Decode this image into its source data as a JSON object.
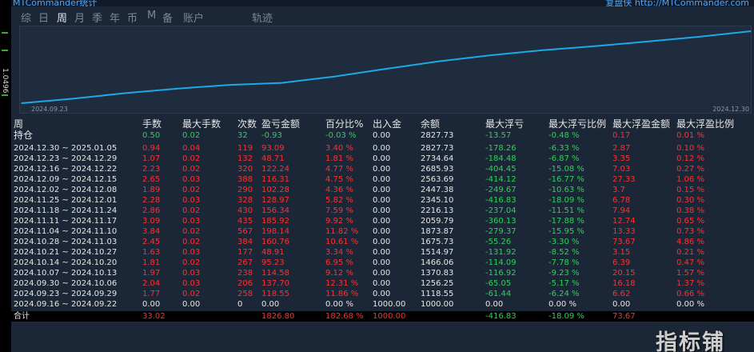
{
  "app": {
    "title_left": "MTCommander统计",
    "title_right": "复盘侠 http://MTCommander.com"
  },
  "side_label": "1.0496",
  "tabs": [
    "综",
    "日",
    "周",
    "月",
    "季",
    "年",
    "币",
    "M",
    "备",
    "账户",
    "轨迹"
  ],
  "active_tab": 2,
  "chart": {
    "start_date": "2024.09.23",
    "end_date": "2024.12.30"
  },
  "chart_data": {
    "type": "line",
    "x": [
      "2024.09.23",
      "2024.09.30",
      "2024.10.07",
      "2024.10.14",
      "2024.10.21",
      "2024.10.28",
      "2024.11.04",
      "2024.11.11",
      "2024.11.18",
      "2024.11.25",
      "2024.12.02",
      "2024.12.09",
      "2024.12.16",
      "2024.12.23",
      "2024.12.30"
    ],
    "y": [
      1000,
      1118.55,
      1256.25,
      1370.83,
      1466.06,
      1514.97,
      1675.73,
      1873.87,
      2059.79,
      2216.13,
      2345.1,
      2447.38,
      2563.69,
      2685.93,
      2827.73
    ],
    "line_color": "#1ea8e6",
    "grid": false
  },
  "table": {
    "headers": [
      "周",
      "手数",
      "最大手数",
      "次数",
      "盈亏金额",
      "百分比%",
      "出入金",
      "余额",
      "最大浮亏",
      "最大浮亏比例",
      "最大浮盈金额",
      "最大浮盈比例"
    ],
    "holding": {
      "label": "持仓",
      "cells": [
        "0.50",
        "0.02",
        "32",
        "-0.93",
        "-0.03 %",
        "0.00",
        "2827.73",
        "-13.57",
        "-0.48 %",
        "0.17",
        "0.01 %"
      ]
    },
    "rows": [
      {
        "period": "2024.12.30 ~ 2025.01.05",
        "cells": [
          "0.94",
          "0.04",
          "119",
          "93.09",
          "3.40 %",
          "0.00",
          "2827.73",
          "-178.26",
          "-6.33 %",
          "2.87",
          "0.10 %"
        ]
      },
      {
        "period": "2024.12.23 ~ 2024.12.29",
        "cells": [
          "1.07",
          "0.02",
          "132",
          "48.71",
          "1.81 %",
          "0.00",
          "2734.64",
          "-184.48",
          "-6.87 %",
          "3.35",
          "0.12 %"
        ]
      },
      {
        "period": "2024.12.16 ~ 2024.12.22",
        "cells": [
          "2.23",
          "0.02",
          "320",
          "122.24",
          "4.77 %",
          "0.00",
          "2685.93",
          "-404.45",
          "-15.08 %",
          "7.03",
          "0.27 %"
        ]
      },
      {
        "period": "2024.12.09 ~ 2024.12.15",
        "cells": [
          "2.65",
          "0.03",
          "388",
          "116.31",
          "4.75 %",
          "0.00",
          "2563.69",
          "-414.12",
          "-16.77 %",
          "27.33",
          "1.06 %"
        ]
      },
      {
        "period": "2024.12.02 ~ 2024.12.08",
        "cells": [
          "1.89",
          "0.02",
          "290",
          "102.28",
          "4.36 %",
          "0.00",
          "2447.38",
          "-249.67",
          "-10.63 %",
          "3.7",
          "0.15 %"
        ]
      },
      {
        "period": "2024.11.25 ~ 2024.12.01",
        "cells": [
          "2.28",
          "0.03",
          "328",
          "128.97",
          "5.82 %",
          "0.00",
          "2345.10",
          "-416.83",
          "-18.09 %",
          "6.78",
          "0.30 %"
        ]
      },
      {
        "period": "2024.11.18 ~ 2024.11.24",
        "cells": [
          "2.86",
          "0.02",
          "430",
          "156.34",
          "7.59 %",
          "0.00",
          "2216.13",
          "-237.04",
          "-11.51 %",
          "7.94",
          "0.38 %"
        ]
      },
      {
        "period": "2024.11.11 ~ 2024.11.17",
        "cells": [
          "3.09",
          "0.03",
          "435",
          "185.92",
          "9.92 %",
          "0.00",
          "2059.79",
          "-360.13",
          "-17.88 %",
          "12.74",
          "0.65 %"
        ]
      },
      {
        "period": "2024.11.04 ~ 2024.11.10",
        "cells": [
          "3.84",
          "0.02",
          "567",
          "198.14",
          "11.82 %",
          "0.00",
          "1873.87",
          "-279.37",
          "-15.95 %",
          "13.33",
          "0.73 %"
        ]
      },
      {
        "period": "2024.10.28 ~ 2024.11.03",
        "cells": [
          "2.45",
          "0.02",
          "384",
          "160.76",
          "10.61 %",
          "0.00",
          "1675.73",
          "-55.26",
          "-3.30 %",
          "73.67",
          "4.86 %"
        ]
      },
      {
        "period": "2024.10.21 ~ 2024.10.27",
        "cells": [
          "1.63",
          "0.03",
          "177",
          "48.91",
          "3.34 %",
          "0.00",
          "1514.97",
          "-131.92",
          "-8.52 %",
          "3.15",
          "0.21 %"
        ]
      },
      {
        "period": "2024.10.14 ~ 2024.10.20",
        "cells": [
          "1.81",
          "0.02",
          "267",
          "95.23",
          "6.95 %",
          "0.00",
          "1466.06",
          "-114.09",
          "-7.78 %",
          "6.39",
          "0.47 %"
        ]
      },
      {
        "period": "2024.10.07 ~ 2024.10.13",
        "cells": [
          "1.97",
          "0.03",
          "238",
          "114.58",
          "9.12 %",
          "0.00",
          "1370.83",
          "-116.92",
          "-9.23 %",
          "20.15",
          "1.57 %"
        ]
      },
      {
        "period": "2024.09.30 ~ 2024.10.06",
        "cells": [
          "2.04",
          "0.03",
          "206",
          "137.70",
          "12.31 %",
          "0.00",
          "1256.25",
          "-65.05",
          "-5.17 %",
          "16.18",
          "1.37 %"
        ]
      },
      {
        "period": "2024.09.23 ~ 2024.09.29",
        "cells": [
          "1.77",
          "0.02",
          "258",
          "118.55",
          "11.86 %",
          "0.00",
          "1118.55",
          "-61.44",
          "-6.24 %",
          "6.62",
          "0.66 %"
        ]
      },
      {
        "period": "2024.09.16 ~ 2024.09.22",
        "cells": [
          "0.00",
          "0.00",
          "0",
          "0.00",
          "0.00 %",
          "1000.00",
          "1000.00",
          "0.00",
          "0.00 %",
          "0.00",
          "0.00 %"
        ]
      }
    ],
    "total": {
      "label": "合计",
      "cells": [
        "33.02",
        "",
        "",
        "1826.80",
        "182.68 %",
        "1000.00",
        "",
        "-416.83",
        "-18.09 %",
        "73.67",
        ""
      ]
    }
  },
  "colors": {
    "positive": "#ff3030",
    "negative": "#2fd05a",
    "neutral": "#e6e6e6"
  },
  "watermark": "指标铺"
}
